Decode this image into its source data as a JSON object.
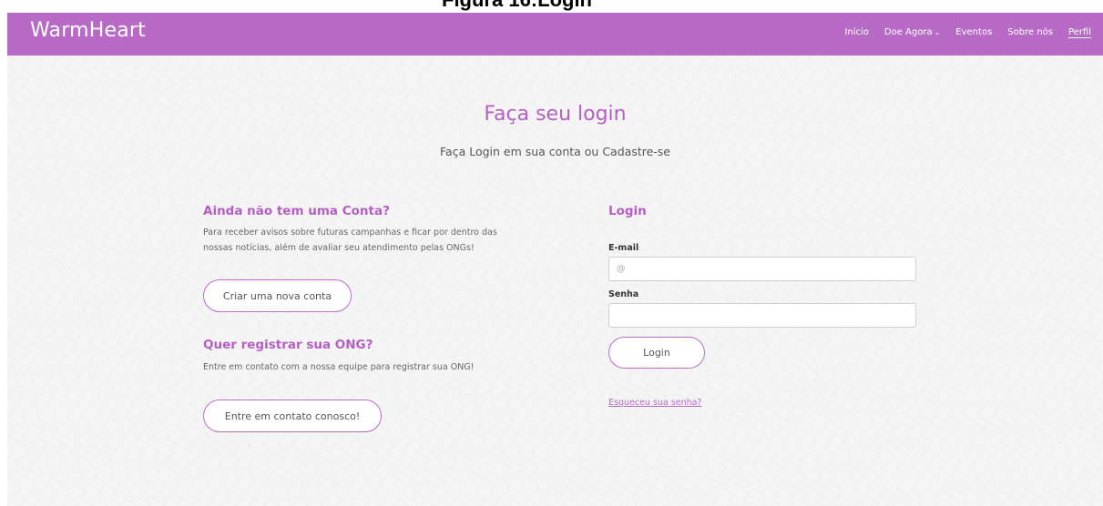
{
  "figure_caption": "Figura 16:Login",
  "navbar": {
    "brand": "WarmHeart",
    "links": [
      {
        "label": "Início"
      },
      {
        "label": "Doe Agora"
      },
      {
        "label": "Eventos"
      },
      {
        "label": "Sobre nós"
      },
      {
        "label": "Perfil"
      }
    ]
  },
  "main": {
    "title": "Faça seu login",
    "subtitle": "Faça Login em sua conta ou Cadastre-se"
  },
  "left": {
    "signup_heading": "Ainda não tem uma Conta?",
    "signup_text_line1": "Para receber avisos sobre futuras campanhas e ficar por dentro das",
    "signup_text_line2": "nossas notícias, além de avaliar seu atendimento pelas ONGs!",
    "signup_button": "Criar uma nova conta",
    "ong_heading": "Quer registrar sua ONG?",
    "ong_text": "Entre em contato com a nossa equipe para registrar sua ONG!",
    "ong_button": "Entre em contato conosco!"
  },
  "login": {
    "heading": "Login",
    "email_label": "E-mail",
    "email_placeholder": "@",
    "password_label": "Senha",
    "password_placeholder": "",
    "submit": "Login",
    "forgot": "Esqueceu sua senha?"
  },
  "colors": {
    "navbar": "#b86ac7",
    "accent": "#b55fc4",
    "background": "#f6f5f6"
  }
}
